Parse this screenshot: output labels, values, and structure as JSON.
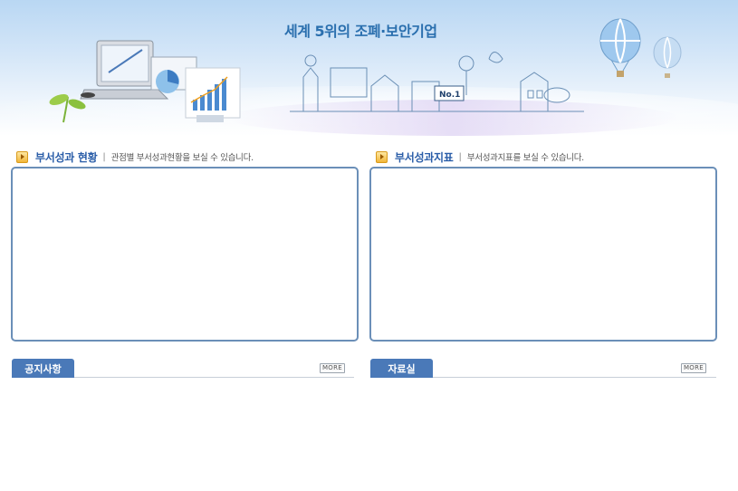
{
  "banner": {
    "slogan": "세계 5위의 조폐·보안기업"
  },
  "sections": [
    {
      "title": "부서성과 현황",
      "description": "관점별 부서성과현황을 보실 수 있습니다."
    },
    {
      "title": "부서성과지표",
      "description": "부서성과지표를 보실 수 있습니다."
    }
  ],
  "boards": [
    {
      "tab_label": "공지사항",
      "more_label": "MORE"
    },
    {
      "tab_label": "자료실",
      "more_label": "MORE"
    }
  ],
  "illustration": {
    "badge_text": "No.1"
  },
  "colors": {
    "accent": "#2a5da8",
    "tab": "#4a79b8",
    "panel_border": "#6b8fb8"
  }
}
